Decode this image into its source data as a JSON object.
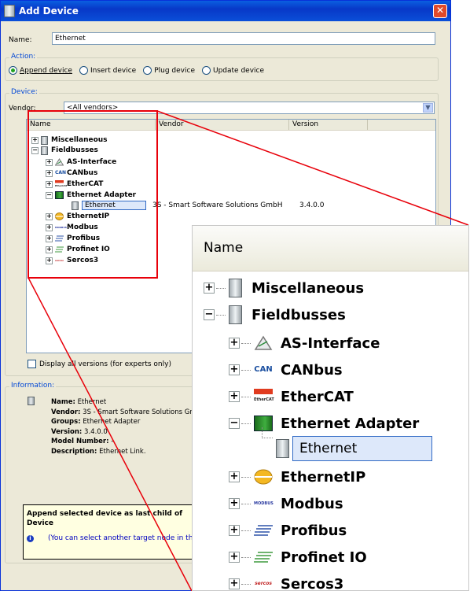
{
  "window": {
    "title": "Add Device",
    "close_label": "✕"
  },
  "name_field": {
    "label": "Name:",
    "value": "Ethernet"
  },
  "action": {
    "group_label": "Action:",
    "options": [
      "Append device",
      "Insert device",
      "Plug device",
      "Update device"
    ],
    "selected": "Append device"
  },
  "device": {
    "group_label": "Device:",
    "vendor_label": "Vendor:",
    "vendor_value": "<All vendors>"
  },
  "tree": {
    "columns": [
      "Name",
      "Vendor",
      "Version"
    ],
    "items": [
      {
        "label": "Miscellaneous",
        "expander": "+"
      },
      {
        "label": "Fieldbusses",
        "expander": "−"
      },
      {
        "label": "AS-Interface",
        "expander": "+",
        "icon": "as-interface-icon"
      },
      {
        "label": "CANbus",
        "expander": "+",
        "icon": "can-icon",
        "icon_text": "CAN"
      },
      {
        "label": "EtherCAT",
        "expander": "+",
        "icon": "ethercat-icon",
        "icon_text": "EtherCAT"
      },
      {
        "label": "Ethernet Adapter",
        "expander": "−",
        "icon": "ethernet-adapter-icon"
      },
      {
        "label": "Ethernet",
        "vendor": "3S - Smart Software Solutions GmbH",
        "version": "3.4.0.0"
      },
      {
        "label": "EthernetIP",
        "expander": "+",
        "icon": "ethernetip-icon"
      },
      {
        "label": "Modbus",
        "expander": "+",
        "icon": "modbus-icon",
        "icon_text": "MODBUS"
      },
      {
        "label": "Profibus",
        "expander": "+",
        "icon": "profibus-icon"
      },
      {
        "label": "Profinet IO",
        "expander": "+",
        "icon": "profinet-icon"
      },
      {
        "label": "Sercos3",
        "expander": "+",
        "icon": "sercos-icon",
        "icon_text": "sercos"
      }
    ]
  },
  "display_all_versions": "Display all versions (for experts only)",
  "information": {
    "group_label": "Information:",
    "name_label": "Name:",
    "name_value": "Ethernet",
    "vendor_label": "Vendor:",
    "vendor_value": "3S - Smart Software Solutions Gr",
    "groups_label": "Groups:",
    "groups_value": "Ethernet Adapter",
    "version_label": "Version:",
    "version_value": "3.4.0.0",
    "model_label": "Model Number:",
    "model_value": "-",
    "description_label": "Description:",
    "description_value": "Ethernet Link."
  },
  "hint": {
    "title_line1": "Append selected device as last child of",
    "title_line2": "Device",
    "info_text": "(You can select another target node in the n"
  },
  "colors": {
    "highlight": "#e8000a",
    "accent": "#0046d5",
    "window_bg": "#ece9d8"
  }
}
